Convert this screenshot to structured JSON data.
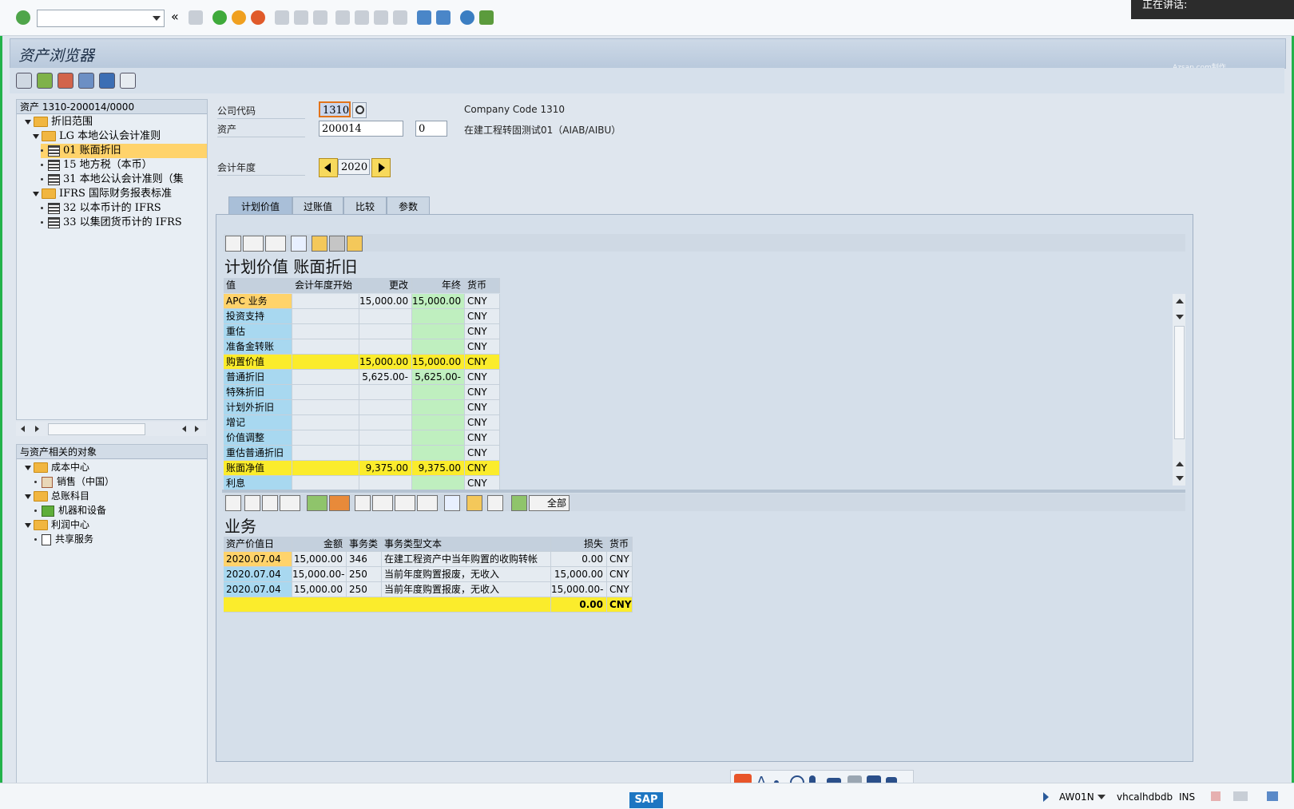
{
  "window": {
    "title": "资产浏览器",
    "speaking_label": "正在讲话:",
    "watermark": "Azsap.com制作"
  },
  "asset_tree": {
    "header": "资产 1310-200014/0000",
    "items": [
      {
        "label": "折旧范围",
        "level": 0,
        "icon": "folder-open-icon"
      },
      {
        "label": "LG 本地公认会计准则",
        "level": 1,
        "icon": "folder-open-icon"
      },
      {
        "label": "01 账面折旧",
        "level": 2,
        "icon": "grid-icon",
        "selected": true
      },
      {
        "label": "15 地方税（本币）",
        "level": 2,
        "icon": "grid-icon"
      },
      {
        "label": "31 本地公认会计准则（集",
        "level": 2,
        "icon": "grid-icon"
      },
      {
        "label": "IFRS 国际财务报表标准",
        "level": 1,
        "icon": "folder-open-icon"
      },
      {
        "label": "32 以本币计的 IFRS",
        "level": 2,
        "icon": "grid-icon"
      },
      {
        "label": "33 以集团货币计的 IFRS",
        "level": 2,
        "icon": "grid-icon"
      }
    ]
  },
  "related_objects": {
    "header": "与资产相关的对象",
    "items": [
      {
        "label": "成本中心",
        "level": 0,
        "icon": "folder-open-icon"
      },
      {
        "label": "销售（中国）",
        "level": 1,
        "icon": "product-icon"
      },
      {
        "label": "总账科目",
        "level": 0,
        "icon": "folder-open-icon"
      },
      {
        "label": "机器和设备",
        "level": 1,
        "icon": "machine-icon"
      },
      {
        "label": "利润中心",
        "level": 0,
        "icon": "folder-open-icon"
      },
      {
        "label": "共享服务",
        "level": 1,
        "icon": "document-icon"
      }
    ]
  },
  "header_fields": {
    "company_code_label": "公司代码",
    "company_code": "1310",
    "company_code_text": "Company Code 1310",
    "asset_label": "资产",
    "asset": "200014",
    "sub_number": "0",
    "asset_text": "在建工程转固测试01（AIAB/AIBU）",
    "fiscal_year_label": "会计年度",
    "fiscal_year": "2020"
  },
  "tabs": [
    {
      "label": "计划价值",
      "active": true
    },
    {
      "label": "过账值"
    },
    {
      "label": "比较"
    },
    {
      "label": "参数"
    }
  ],
  "planned_values": {
    "title": "计划价值 账面折旧",
    "columns": [
      "值",
      "会计年度开始",
      "更改",
      "年终",
      "货币"
    ],
    "rows": [
      {
        "name": "APC 业务",
        "start": "",
        "change": "15,000.00",
        "end": "15,000.00",
        "cur": "CNY",
        "style": "orange"
      },
      {
        "name": "投资支持",
        "start": "",
        "change": "",
        "end": "",
        "cur": "CNY"
      },
      {
        "name": "重估",
        "start": "",
        "change": "",
        "end": "",
        "cur": "CNY"
      },
      {
        "name": "准备金转账",
        "start": "",
        "change": "",
        "end": "",
        "cur": "CNY"
      },
      {
        "name": "购置价值",
        "start": "",
        "change": "15,000.00",
        "end": "15,000.00",
        "cur": "CNY",
        "style": "yellow"
      },
      {
        "name": "普通折旧",
        "start": "",
        "change": "5,625.00-",
        "end": "5,625.00-",
        "cur": "CNY"
      },
      {
        "name": "特殊折旧",
        "start": "",
        "change": "",
        "end": "",
        "cur": "CNY"
      },
      {
        "name": "计划外折旧",
        "start": "",
        "change": "",
        "end": "",
        "cur": "CNY"
      },
      {
        "name": "增记",
        "start": "",
        "change": "",
        "end": "",
        "cur": "CNY"
      },
      {
        "name": "价值调整",
        "start": "",
        "change": "",
        "end": "",
        "cur": "CNY"
      },
      {
        "name": "重估普通折旧",
        "start": "",
        "change": "",
        "end": "",
        "cur": "CNY"
      },
      {
        "name": "账面净值",
        "start": "",
        "change": "9,375.00",
        "end": "9,375.00",
        "cur": "CNY",
        "style": "yellow"
      },
      {
        "name": "利息",
        "start": "",
        "change": "",
        "end": "",
        "cur": "CNY"
      }
    ]
  },
  "transactions": {
    "title": "业务",
    "all_label": "全部",
    "columns": [
      "资产价值日",
      "金额",
      "事务类",
      "事务类型文本",
      "损失",
      "货币"
    ],
    "rows": [
      {
        "date": "2020.07.04",
        "amount": "15,000.00",
        "type": "346",
        "text": "在建工程资产中当年购置的收购转帐",
        "loss": "0.00",
        "cur": "CNY"
      },
      {
        "date": "2020.07.04",
        "amount": "15,000.00-",
        "type": "250",
        "text": "当前年度购置报废，无收入",
        "loss": "15,000.00",
        "cur": "CNY"
      },
      {
        "date": "2020.07.04",
        "amount": "15,000.00",
        "type": "250",
        "text": "当前年度购置报废，无收入",
        "loss": "15,000.00-",
        "cur": "CNY"
      }
    ],
    "total": {
      "loss": "0.00",
      "cur": "CNY"
    }
  },
  "statusbar": {
    "transaction": "AW01N",
    "server": "vhcalhdbdb",
    "mode": "INS",
    "sap": "SAP"
  },
  "ime_label": "A"
}
